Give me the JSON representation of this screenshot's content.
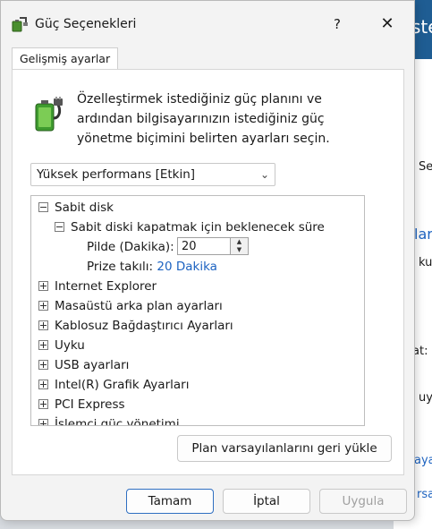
{
  "background_window": {
    "header_text": "ste",
    "fragments": [
      {
        "text": "Se"
      },
      {
        "text": "ları",
        "link": true
      },
      {
        "text": "ku"
      },
      {
        "text": "at:"
      },
      {
        "text": "uyk"
      },
      {
        "text": "ayarl",
        "link": true
      },
      {
        "text": "rsay",
        "link": true
      }
    ]
  },
  "dialog": {
    "title": "Güç Seçenekleri",
    "help_label": "?",
    "close_label": "✕",
    "tab_label": "Gelişmiş ayarlar",
    "description": "Özelleştirmek istediğiniz güç planını ve ardından bilgisayarınızın istediğiniz güç yönetme biçimini belirten ayarları seçin.",
    "plan_select": {
      "value": "Yüksek performans [Etkin]"
    },
    "tree": {
      "root": "Sabit disk",
      "child": "Sabit diski kapatmak için beklenecek süre",
      "setting_label": "Pilde (Dakika):",
      "setting_value": "20",
      "plugged_label": "Prize takılı:",
      "plugged_value": "20 Dakika",
      "items": [
        "Internet Explorer",
        "Masaüstü arka plan ayarları",
        "Kablosuz Bağdaştırıcı Ayarları",
        "Uyku",
        "USB ayarları",
        "Intel(R) Grafik Ayarları",
        "PCI Express",
        "İşlemci güç yönetimi"
      ]
    },
    "restore_button": "Plan varsayılanlarını geri yükle",
    "ok_button": "Tamam",
    "cancel_button": "İptal",
    "apply_button": "Uygula"
  },
  "colors": {
    "link": "#1d63c1",
    "accent": "#2f6fc1",
    "background_header": "#1f5d93"
  }
}
